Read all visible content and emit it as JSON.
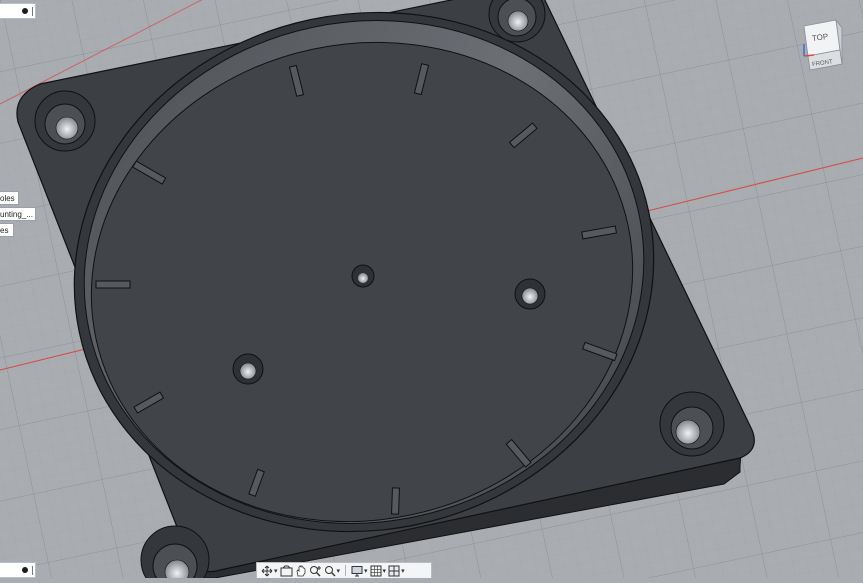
{
  "browser_panel": {
    "items": [
      {
        "label": "oles"
      },
      {
        "label": "unting_..."
      },
      {
        "label": "es"
      }
    ]
  },
  "view_cube": {
    "top_label": "TOP",
    "front_label": "FRONT"
  },
  "navigation_bar": {
    "tools": [
      {
        "name": "orbit-tool",
        "icon": "orbit-icon",
        "has_menu": true
      },
      {
        "name": "look-at-tool",
        "icon": "look-at-icon",
        "has_menu": false
      },
      {
        "name": "pan-tool",
        "icon": "hand-icon",
        "has_menu": false
      },
      {
        "name": "zoom-tool",
        "icon": "zoom-icon",
        "has_menu": false
      },
      {
        "name": "fit-tool",
        "icon": "zoom-window-icon",
        "has_menu": true
      },
      {
        "name": "display-settings-tool",
        "icon": "monitor-icon",
        "has_menu": true
      },
      {
        "name": "grid-settings-tool",
        "icon": "grid-icon",
        "has_menu": true
      },
      {
        "name": "viewports-tool",
        "icon": "viewports-icon",
        "has_menu": true
      }
    ]
  },
  "colors": {
    "background": "#a9adb2",
    "model_body": "#3c3f44",
    "model_edge": "#111111",
    "axis_red": "#d44a4a"
  }
}
